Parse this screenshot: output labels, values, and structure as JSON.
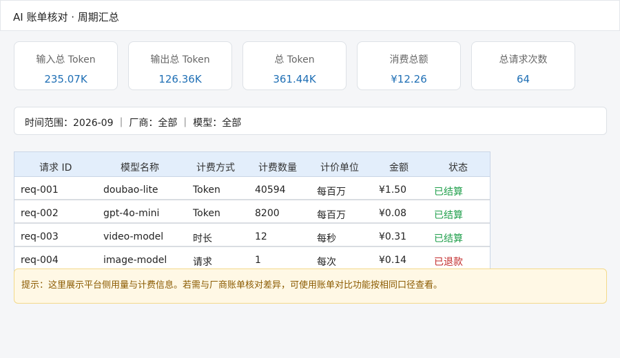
{
  "header": {
    "title": "AI 账单核对 · 周期汇总"
  },
  "stats": [
    {
      "label": "输入总 Token",
      "value": "235.07K"
    },
    {
      "label": "输出总 Token",
      "value": "126.36K"
    },
    {
      "label": "总 Token",
      "value": "361.44K"
    },
    {
      "label": "消费总额",
      "value": "¥12.26"
    },
    {
      "label": "总请求次数",
      "value": "64"
    }
  ],
  "filter": {
    "text": "时间范围：2026-09 ｜ 厂商：全部 ｜ 模型：全部"
  },
  "table": {
    "columns": [
      "请求 ID",
      "模型名称",
      "计费方式",
      "计费数量",
      "计价单位",
      "金额",
      "状态"
    ],
    "rows": [
      {
        "id": "req-001",
        "model": "doubao-lite",
        "method": "Token",
        "qty": "40594",
        "unit": "每百万",
        "amount": "¥1.50",
        "status": "已结算"
      },
      {
        "id": "req-002",
        "model": "gpt-4o-mini",
        "method": "Token",
        "qty": "8200",
        "unit": "每百万",
        "amount": "¥0.08",
        "status": "已结算"
      },
      {
        "id": "req-003",
        "model": "video-model",
        "method": "时长",
        "qty": "12",
        "unit": "每秒",
        "amount": "¥0.31",
        "status": "已结算"
      },
      {
        "id": "req-004",
        "model": "image-model",
        "method": "请求",
        "qty": "1",
        "unit": "每次",
        "amount": "¥0.14",
        "status": "已退款"
      }
    ]
  },
  "notice": {
    "text": "提示：这里展示平台侧用量与计费信息。若需与厂商账单核对差异，可使用账单对比功能按相同口径查看。"
  },
  "colors": {
    "accent": "#1f6fb5",
    "settled": "#1e9e4a",
    "refunded": "#c22b2b",
    "notice_bg": "#fff8e5"
  }
}
